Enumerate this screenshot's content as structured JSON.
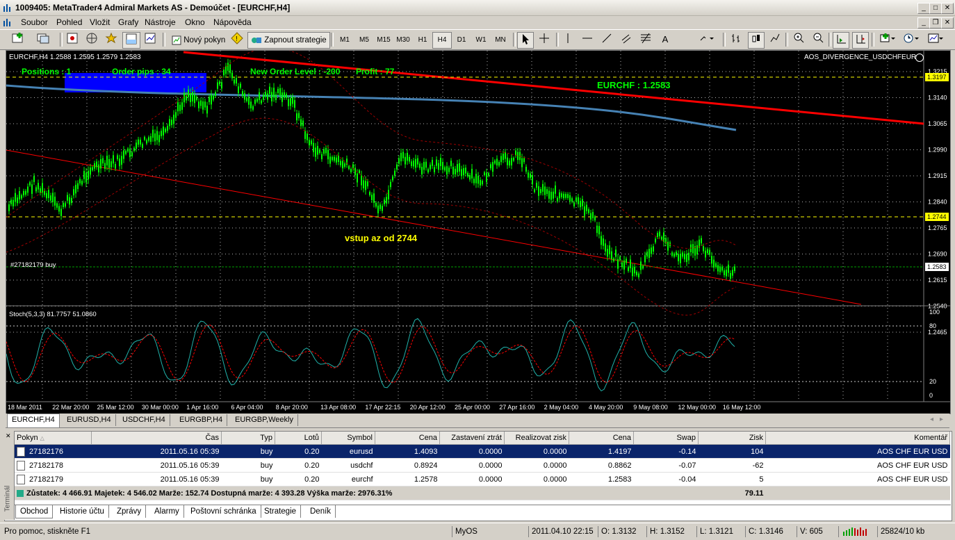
{
  "window": {
    "title": "1009405: MetaTrader4 Admiral Markets AS - Demoúčet - [EURCHF,H4]"
  },
  "menu": [
    "Soubor",
    "Pohled",
    "Vložit",
    "Grafy",
    "Nástroje",
    "Okno",
    "Nápověda"
  ],
  "toolbar": {
    "new_order": "Nový pokyn",
    "strategy": "Zapnout strategie",
    "timeframes": [
      "M1",
      "M5",
      "M15",
      "M30",
      "H1",
      "H4",
      "D1",
      "W1",
      "MN"
    ],
    "active_timeframe": "H4"
  },
  "chart": {
    "header": "EURCHF,H4  1.2588 1.2595 1.2579 1.2583",
    "indicator_name": "AOS_DIVERGENCE_USDCHFEUR",
    "positions": "Positions : 1",
    "order_pips": "Order pips : 34",
    "new_order_level": "New Order Level : -200",
    "profit": "Profit : 77",
    "symbol_price": "EURCHF : 1.2583",
    "note": "vstup az od 2744",
    "order_label": "#27182179 buy",
    "price_labels": [
      "1.3215",
      "1.3140",
      "1.3065",
      "1.2990",
      "1.2915",
      "1.2840",
      "1.2765",
      "1.2690",
      "1.2615",
      "1.2540",
      "1.2465"
    ],
    "marker_labels": [
      "1.3197",
      "1.2744",
      "1.2583"
    ],
    "stoch_header": "Stoch(5,3,3) 81.7757 51.0860",
    "stoch_levels": [
      "100",
      "80",
      "20",
      "0"
    ],
    "time_labels": [
      "18 Mar 2011",
      "22 Mar 20:00",
      "25 Mar 12:00",
      "30 Mar 00:00",
      "1 Apr 16:00",
      "6 Apr 04:00",
      "8 Apr 20:00",
      "13 Apr 08:00",
      "17 Apr 22:15",
      "20 Apr 12:00",
      "25 Apr 00:00",
      "27 Apr 16:00",
      "2 May 04:00",
      "4 May 20:00",
      "9 May 08:00",
      "12 May 00:00",
      "16 May 12:00"
    ],
    "colors": {
      "candles": "#00ff00",
      "trend": "#ff0000",
      "ma": "#4682b4",
      "dashed": "#ffff00",
      "text_green": "#00ff00",
      "stoch_main": "#20b2aa",
      "stoch_signal": "#ff0000"
    }
  },
  "chart_tabs": [
    "EURCHF,H4",
    "EURUSD,H4",
    "USDCHF,H4",
    "EURGBP,H4",
    "EURGBP,Weekly"
  ],
  "terminal": {
    "columns": [
      "Pokyn",
      "Čas",
      "Typ",
      "Lotů",
      "Symbol",
      "Cena",
      "Zastavení ztrát",
      "Realizovat zisk",
      "Cena",
      "Swap",
      "Zisk",
      "Komentář"
    ],
    "rows": [
      [
        "27182176",
        "2011.05.16 05:39",
        "buy",
        "0.20",
        "eurusd",
        "1.4093",
        "0.0000",
        "0.0000",
        "1.4197",
        "-0.14",
        "104",
        "AOS CHF EUR USD"
      ],
      [
        "27182178",
        "2011.05.16 05:39",
        "buy",
        "0.20",
        "usdchf",
        "0.8924",
        "0.0000",
        "0.0000",
        "0.8862",
        "-0.07",
        "-62",
        "AOS CHF EUR USD"
      ],
      [
        "27182179",
        "2011.05.16 05:39",
        "buy",
        "0.20",
        "eurchf",
        "1.2578",
        "0.0000",
        "0.0000",
        "1.2583",
        "-0.04",
        "5",
        "AOS CHF EUR USD"
      ]
    ],
    "summary": "Zůstatek: 4 466.91  Majetek: 4 546.02  Marže: 152.74  Dostupná marže: 4 393.28  Výška marže: 2976.31%",
    "summary_profit": "79.11",
    "side_label": "Terminál",
    "tabs": [
      "Obchod",
      "Historie účtu",
      "Zprávy",
      "Alarmy",
      "Poštovní schránka",
      "Strategie",
      "Deník"
    ]
  },
  "status": {
    "help": "Pro pomoc, stiskněte F1",
    "profile": "MyOS",
    "datetime": "2011.04.10 22:15",
    "open": "O: 1.3132",
    "high": "H: 1.3152",
    "low": "L: 1.3121",
    "close": "C: 1.3146",
    "volume": "V: 605",
    "traffic": "25824/10 kb"
  }
}
